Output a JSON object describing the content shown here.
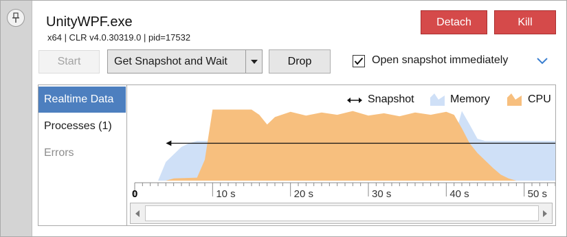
{
  "process": {
    "name": "UnityWPF.exe",
    "details": "x64 | CLR v4.0.30319.0 | pid=17532"
  },
  "toolbar": {
    "detach_label": "Detach",
    "kill_label": "Kill",
    "start_label": "Start",
    "snapshot_mode": "Get Snapshot and Wait",
    "drop_label": "Drop",
    "open_immediately_label": "Open snapshot immediately",
    "open_immediately_checked": true
  },
  "nav": {
    "items": [
      {
        "label": "Realtime Data",
        "state": "selected"
      },
      {
        "label": "Processes (1)",
        "state": "normal"
      },
      {
        "label": "Errors",
        "state": "disabled"
      }
    ]
  },
  "legend": {
    "snapshot": "Snapshot",
    "memory": "Memory",
    "cpu": "CPU"
  },
  "colors": {
    "accent_blue": "#4d7fbf",
    "kill_red": "#d54a4a",
    "memory_fill": "#cfe0f7",
    "cpu_fill": "#f7bf7e"
  },
  "chart_data": {
    "type": "area",
    "xlabel": "",
    "ylabel": "",
    "xlim": [
      0,
      54
    ],
    "ylim": [
      0,
      100
    ],
    "x_ticks": [
      {
        "value": 0,
        "label": "0"
      },
      {
        "value": 10,
        "label": "10 s"
      },
      {
        "value": 20,
        "label": "20 s"
      },
      {
        "value": 30,
        "label": "30 s"
      },
      {
        "value": 40,
        "label": "40 s"
      },
      {
        "value": 50,
        "label": "50 s"
      }
    ],
    "series": [
      {
        "name": "Memory",
        "points": [
          [
            3,
            0
          ],
          [
            4,
            25
          ],
          [
            5,
            35
          ],
          [
            6,
            45
          ],
          [
            7,
            50
          ],
          [
            8,
            53
          ],
          [
            9,
            53
          ],
          [
            10,
            53
          ],
          [
            40,
            53
          ],
          [
            41,
            55
          ],
          [
            42,
            93
          ],
          [
            43,
            75
          ],
          [
            44,
            56
          ],
          [
            45,
            53
          ],
          [
            54,
            53
          ]
        ]
      },
      {
        "name": "CPU",
        "points": [
          [
            4,
            0
          ],
          [
            5,
            3
          ],
          [
            8,
            4
          ],
          [
            9,
            28
          ],
          [
            10,
            95
          ],
          [
            15,
            95
          ],
          [
            16,
            88
          ],
          [
            17,
            75
          ],
          [
            18,
            85
          ],
          [
            20,
            92
          ],
          [
            22,
            87
          ],
          [
            24,
            91
          ],
          [
            26,
            88
          ],
          [
            28,
            93
          ],
          [
            30,
            87
          ],
          [
            32,
            90
          ],
          [
            34,
            86
          ],
          [
            36,
            91
          ],
          [
            38,
            88
          ],
          [
            40,
            92
          ],
          [
            41,
            88
          ],
          [
            42,
            70
          ],
          [
            43,
            50
          ],
          [
            44,
            37
          ],
          [
            45,
            27
          ],
          [
            46,
            17
          ],
          [
            47,
            8
          ],
          [
            48,
            3
          ],
          [
            49,
            0
          ]
        ]
      }
    ],
    "snapshot_marker": {
      "from_x": 54,
      "to_x": 4,
      "level": 50
    }
  }
}
